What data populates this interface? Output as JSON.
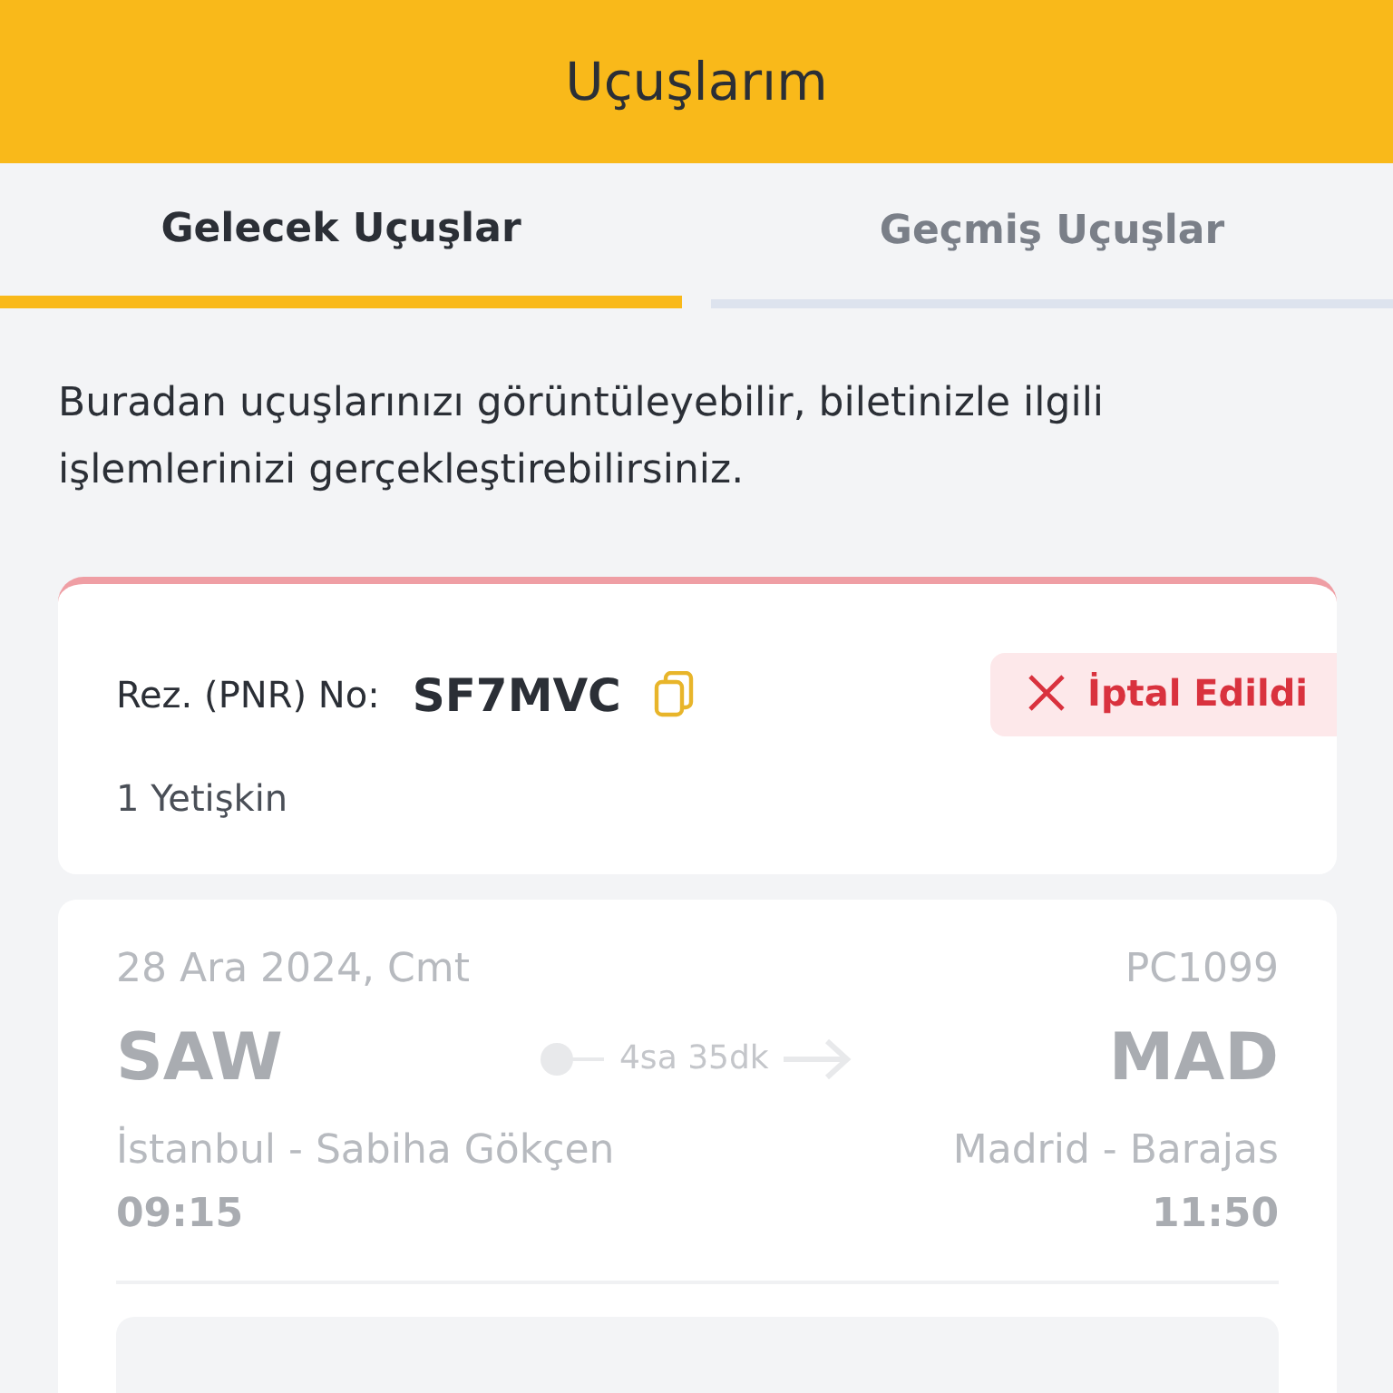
{
  "header": {
    "title": "Uçuşlarım"
  },
  "tabs": [
    {
      "label": "Gelecek Uçuşlar",
      "selected": true
    },
    {
      "label": "Geçmiş Uçuşlar",
      "selected": false
    }
  ],
  "intro": "Buradan uçuşlarınızı görüntüleyebilir, biletinizle ilgili işlemlerinizi gerçekleştirebilirsiniz.",
  "booking": {
    "pnr_label": "Rez. (PNR) No:",
    "pnr": "SF7MVC",
    "passengers": "1 Yetişkin",
    "status": {
      "kind": "cancelled",
      "label": "İptal Edildi"
    },
    "flight": {
      "date": "28 Ara 2024, Cmt",
      "flight_number": "PC1099",
      "origin_code": "SAW",
      "destination_code": "MAD",
      "duration": "4sa 35dk",
      "origin_airport": "İstanbul - Sabiha Gökçen",
      "destination_airport": "Madrid - Barajas",
      "departure": "09:15",
      "arrival": "11:50"
    }
  }
}
